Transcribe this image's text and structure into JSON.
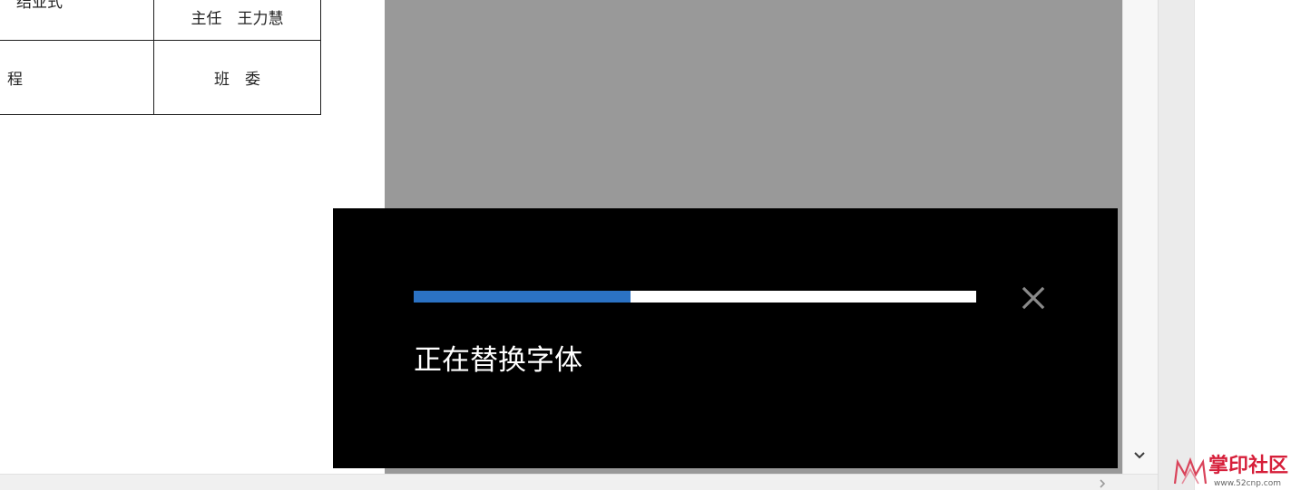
{
  "document": {
    "table": {
      "rows": [
        {
          "left_cell": "结业式",
          "right_cell": "主任　王力慧"
        },
        {
          "left_cell": "程",
          "right_cell": "班　委"
        }
      ]
    }
  },
  "dialog": {
    "message": "正在替换字体",
    "progress_percent": 38.5,
    "progress_fill_color": "#2b72c4",
    "close_icon": "close-icon"
  },
  "scrollbar": {
    "down_icon": "chevron-down-icon",
    "right_icon": "chevron-right-icon"
  },
  "watermark": {
    "brand_text": "掌印社区",
    "url_text": "www.52cnp.com"
  }
}
